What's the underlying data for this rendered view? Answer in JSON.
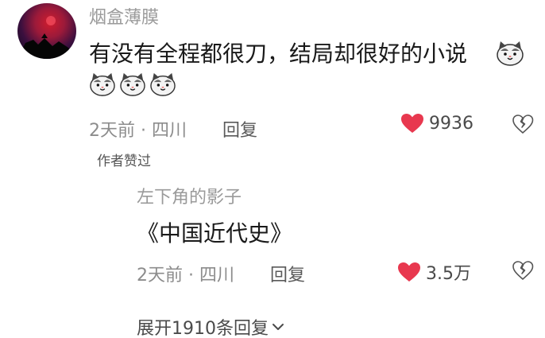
{
  "comment": {
    "username": "烟盒薄膜",
    "text": "有没有全程都很刀，结局却很好的小说",
    "emoji": "cat-face-emoji",
    "time": "2天前",
    "location": "四川",
    "reply_label": "回复",
    "likes": "9936",
    "author_liked": "作者赞过"
  },
  "reply": {
    "username": "左下角的影子",
    "text": "《中国近代史》",
    "time": "2天前",
    "location": "四川",
    "reply_label": "回复",
    "likes": "3.5万"
  },
  "expand_label": "展开1910条回复",
  "colors": {
    "heart": "#e8384f",
    "muted_text": "#9a9a9a",
    "body_text": "#1a1a1a"
  }
}
